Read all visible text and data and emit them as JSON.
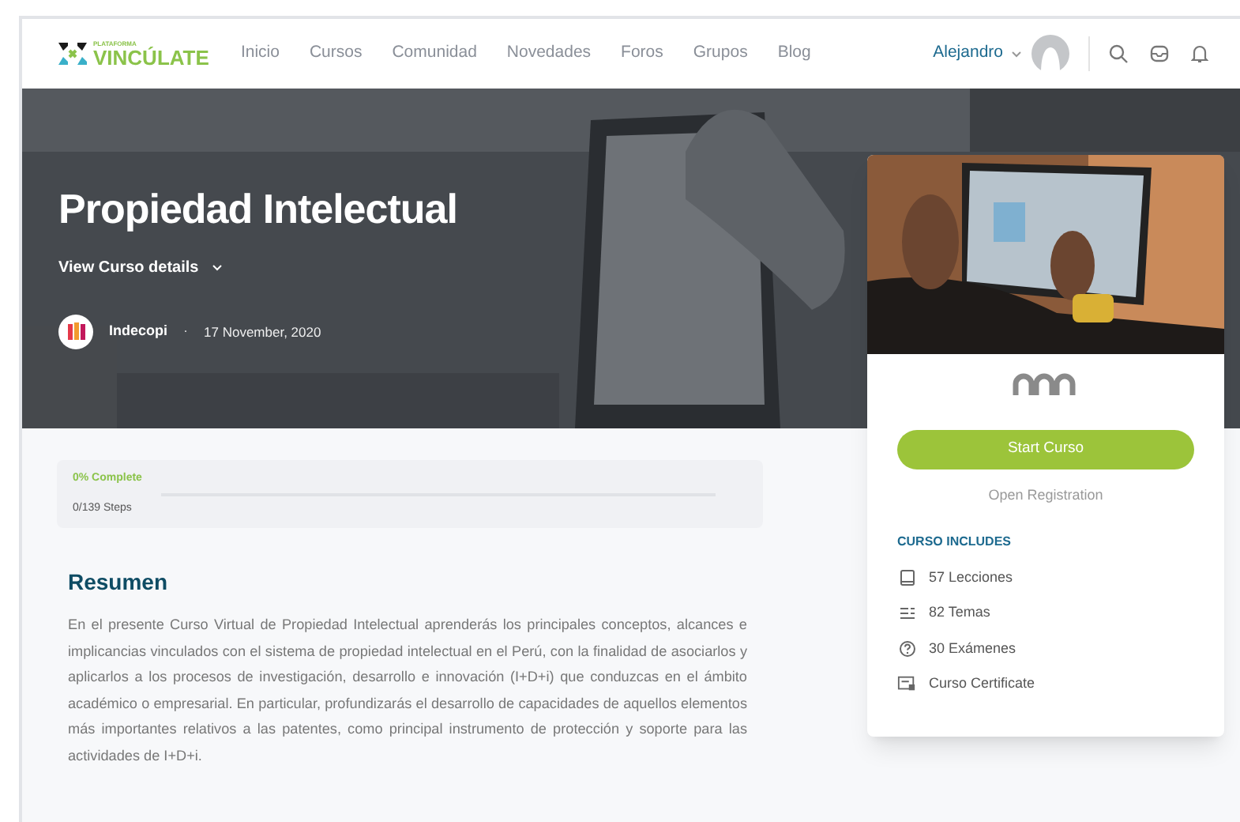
{
  "header": {
    "logo": {
      "small": "PLATAFORMA",
      "name": "VINCÚLATE"
    },
    "nav": [
      {
        "label": "Inicio"
      },
      {
        "label": "Cursos"
      },
      {
        "label": "Comunidad"
      },
      {
        "label": "Novedades"
      },
      {
        "label": "Foros"
      },
      {
        "label": "Grupos"
      },
      {
        "label": "Blog"
      }
    ],
    "user": "Alejandro"
  },
  "hero": {
    "title": "Propiedad Intelectual",
    "details_toggle": "View Curso details",
    "author": "Indecopi",
    "separator": "·",
    "date": "17 November, 2020"
  },
  "progress": {
    "percent": "0% Complete",
    "steps": "0/139 Steps",
    "level": 0
  },
  "summary": {
    "heading": "Resumen",
    "text": "En el presente Curso Virtual de Propiedad Intelectual aprenderás los principales conceptos, alcances e implicancias vinculados con el sistema de propiedad intelectual en el Perú, con la finalidad de asociarlos y aplicarlos a los procesos de investigación, desarrollo e innovación (I+D+i) que conduzcas en el ámbito académico o empresarial. En particular, profundizarás el desarrollo de capacidades de aquellos elementos más importantes relativos a las patentes, como principal instrumento de protección y soporte para las actividades de I+D+i."
  },
  "card": {
    "button": "Start Curso",
    "status": "Open Registration",
    "includes_heading": "CURSO INCLUDES",
    "includes": [
      {
        "kind": "lessons",
        "label": "57 Lecciones"
      },
      {
        "kind": "topics",
        "label": "82 Temas"
      },
      {
        "kind": "quizzes",
        "label": "30 Exámenes"
      },
      {
        "kind": "certificate",
        "label": "Curso Certificate"
      }
    ]
  }
}
